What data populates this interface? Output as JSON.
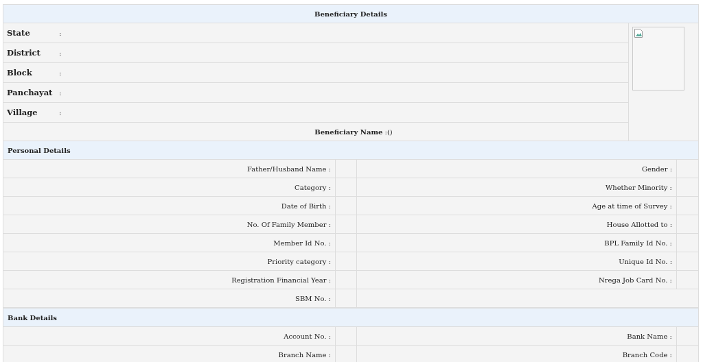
{
  "header": "Beneficiary Details",
  "location_fields": [
    {
      "label": "State",
      "separator": ":"
    },
    {
      "label": "District",
      "separator": ":"
    },
    {
      "label": "Block",
      "separator": ":"
    },
    {
      "label": "Panchayat",
      "separator": ":"
    },
    {
      "label": "Village",
      "separator": ":"
    }
  ],
  "beneficiary_name": "**Beneficiary Name** :()",
  "photo": {
    "kind": "broken-image"
  },
  "sections": [
    {
      "title": "Personal Details",
      "rows": [
        {
          "left": "Father/Husband Name :",
          "right": "Gender :"
        },
        {
          "left": "Category :",
          "right": "Whether Minority :"
        },
        {
          "left": "Date of Birth :",
          "right": "Age at time of Survey :"
        },
        {
          "left": "No. Of Family Member :",
          "right": "House Allotted to :"
        },
        {
          "left": "Member Id No. :",
          "right": "BPL Family Id No. :"
        },
        {
          "left": "Priority category :",
          "right": "Unique Id No. :"
        },
        {
          "left": "Registration Financial Year :",
          "right": "Nrega Job Card No. :"
        },
        {
          "left": "SBM No. :"
        }
      ]
    },
    {
      "title": "Bank Details",
      "rows": [
        {
          "left": "Account No. :",
          "right": "Bank Name :"
        },
        {
          "left": "Branch Name :",
          "right": "Branch Code :"
        }
      ]
    }
  ]
}
